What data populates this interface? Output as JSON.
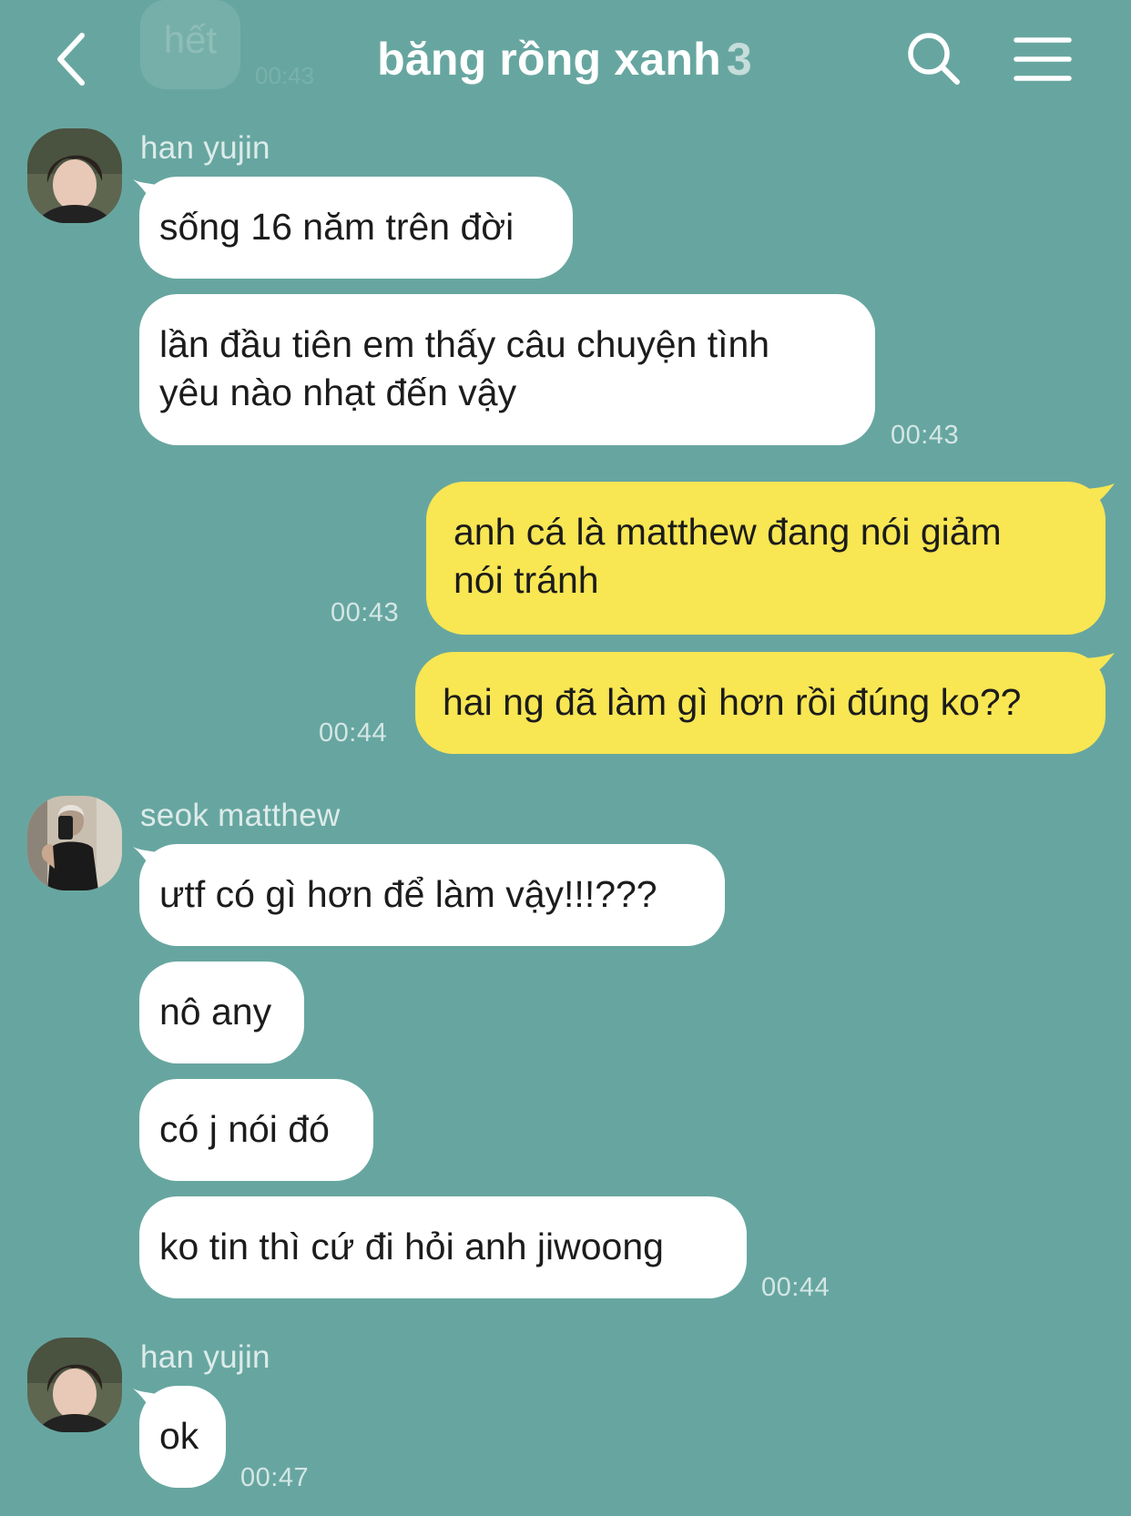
{
  "header": {
    "title": "băng rồng xanh",
    "member_count": "3",
    "ghost_text": "hết",
    "ghost_time": "00:43"
  },
  "messages": [
    {
      "sender": "han yujin",
      "text": "sống 16 năm trên đời"
    },
    {
      "text": "lần đầu tiên em thấy câu chuyện tình yêu nào nhạt đến vậy",
      "line1": "lần đầu tiên em thấy câu chuyện tình",
      "line2": "yêu nào nhạt đến vậy",
      "time": "00:43"
    },
    {
      "text": "anh cá là matthew đang nói giảm nói tránh",
      "line1": "anh cá là matthew đang nói giảm",
      "line2": "nói tránh",
      "time": "00:43"
    },
    {
      "text": "hai ng đã làm gì hơn rồi đúng ko??",
      "time": "00:44"
    },
    {
      "sender": "seok matthew",
      "text": "ưtf có gì hơn để làm vậy!!!???"
    },
    {
      "text": "nô any"
    },
    {
      "text": "có j nói đó"
    },
    {
      "text": "ko tin thì cứ đi hỏi anh jiwoong",
      "time": "00:44"
    },
    {
      "sender": "han yujin",
      "text": "ok",
      "time": "00:47"
    }
  ],
  "icons": {
    "back": "chevron-left-icon",
    "search": "search-icon",
    "menu": "menu-icon"
  },
  "colors": {
    "background": "#67a6a0",
    "incoming_bubble": "#ffffff",
    "outgoing_bubble": "#f8e653",
    "header_text": "#ffffff"
  }
}
